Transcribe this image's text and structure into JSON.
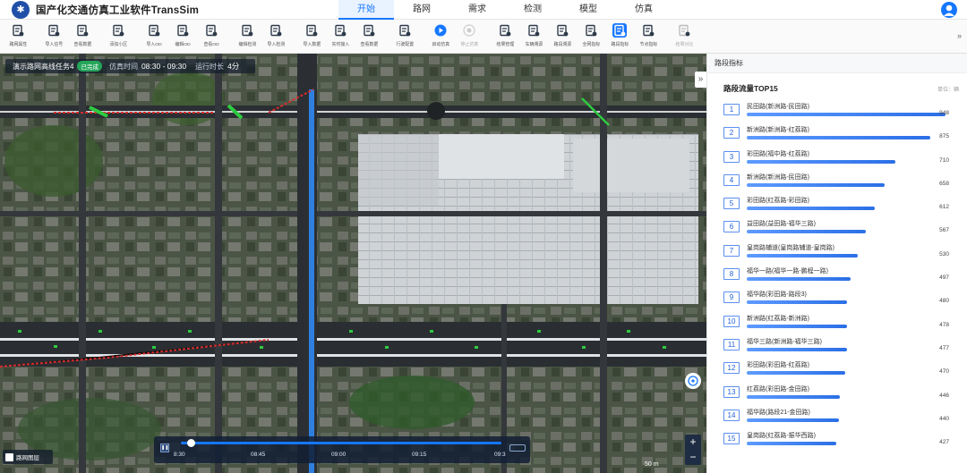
{
  "header": {
    "app_title": "国产化交通仿真工业软件TransSim",
    "tabs": [
      {
        "label": "开始",
        "active": true
      },
      {
        "label": "路网",
        "active": false
      },
      {
        "label": "需求",
        "active": false
      },
      {
        "label": "检测",
        "active": false
      },
      {
        "label": "模型",
        "active": false
      },
      {
        "label": "仿真",
        "active": false
      }
    ]
  },
  "toolbar": {
    "groups": [
      [
        {
          "label": "路网属性",
          "icon": "network-attr-icon"
        }
      ],
      [
        {
          "label": "导入信号",
          "icon": "import-signal-icon"
        },
        {
          "label": "查看数据",
          "icon": "view-data-icon"
        }
      ],
      [
        {
          "label": "添加小区",
          "icon": "add-zone-icon"
        }
      ],
      [
        {
          "label": "导入OD",
          "icon": "import-od-icon"
        },
        {
          "label": "编辑OD",
          "icon": "edit-od-icon"
        },
        {
          "label": "查看OD",
          "icon": "view-od-icon"
        }
      ],
      [
        {
          "label": "编辑检测",
          "icon": "edit-detector-icon"
        },
        {
          "label": "导入检测",
          "icon": "import-detector-icon"
        }
      ],
      [
        {
          "label": "导入数据",
          "icon": "import-data-icon"
        },
        {
          "label": "实时接入",
          "icon": "realtime-icon"
        },
        {
          "label": "查看数据",
          "icon": "view-data-icon"
        }
      ],
      [
        {
          "label": "行驶配置",
          "icon": "drive-config-icon"
        }
      ],
      [
        {
          "label": "启动仿真",
          "icon": "start-sim-icon"
        },
        {
          "label": "停止仿真",
          "icon": "stop-sim-icon",
          "dim": true
        }
      ],
      [
        {
          "label": "结果管理",
          "icon": "result-mgmt-icon"
        },
        {
          "label": "车辆溯源",
          "icon": "vehicle-trace-icon"
        },
        {
          "label": "路段溯源",
          "icon": "link-trace-icon"
        },
        {
          "label": "全网指标",
          "icon": "global-metric-icon"
        },
        {
          "label": "路段指标",
          "icon": "link-metric-icon",
          "active": true
        },
        {
          "label": "节点指标",
          "icon": "node-metric-icon"
        }
      ],
      [
        {
          "label": "结果对比",
          "icon": "result-compare-icon",
          "dim": true
        }
      ]
    ],
    "more": "»"
  },
  "map": {
    "task_name": "演示路网高线任务4",
    "status": "已完成",
    "sim_time_label": "仿真时间",
    "sim_time": "08:30 - 09:30",
    "elapsed_label": "运行时长",
    "elapsed": "4分",
    "collapse": "»",
    "layer_label": "路网图层",
    "scale": "50 m",
    "zoom_in": "+",
    "zoom_out": "−"
  },
  "timeline": {
    "ticks": [
      "8:30",
      "08:45",
      "09:00",
      "09:15",
      "09:3"
    ],
    "progress": 0.02
  },
  "panel": {
    "header": "路段指标",
    "subtitle": "路段流量TOP15",
    "unit": "单位：辆",
    "max": 948
  },
  "chart_data": {
    "type": "bar",
    "title": "路段流量TOP15",
    "ylabel": "单位：辆",
    "categories": [
      "民田路(新洲路-民田路)",
      "新洲路(新洲路-红荔路)",
      "彩田路(福中路-红荔路)",
      "新洲路(新洲路-民田路)",
      "彩田路(红荔路-彩田路)",
      "益田路(益田路-福华三路)",
      "皇岗路辅道(皇岗路辅道-皇岗路)",
      "福华一路(福华一路-鹏程一路)",
      "福华路(彩田路-路段3)",
      "新洲路(红荔路-新洲路)",
      "福华三路(新洲路-福华三路)",
      "彩田路(彩田路-红荔路)",
      "红荔路(彩田路-金田路)",
      "福华路(路段21-金田路)",
      "皇岗路(红荔路-振华西路)"
    ],
    "values": [
      948,
      875,
      710,
      658,
      612,
      567,
      530,
      497,
      480,
      478,
      477,
      470,
      446,
      440,
      427
    ]
  },
  "colors": {
    "accent": "#1677ff",
    "bar": "#3b7ef0",
    "status_green": "#25a55a"
  }
}
